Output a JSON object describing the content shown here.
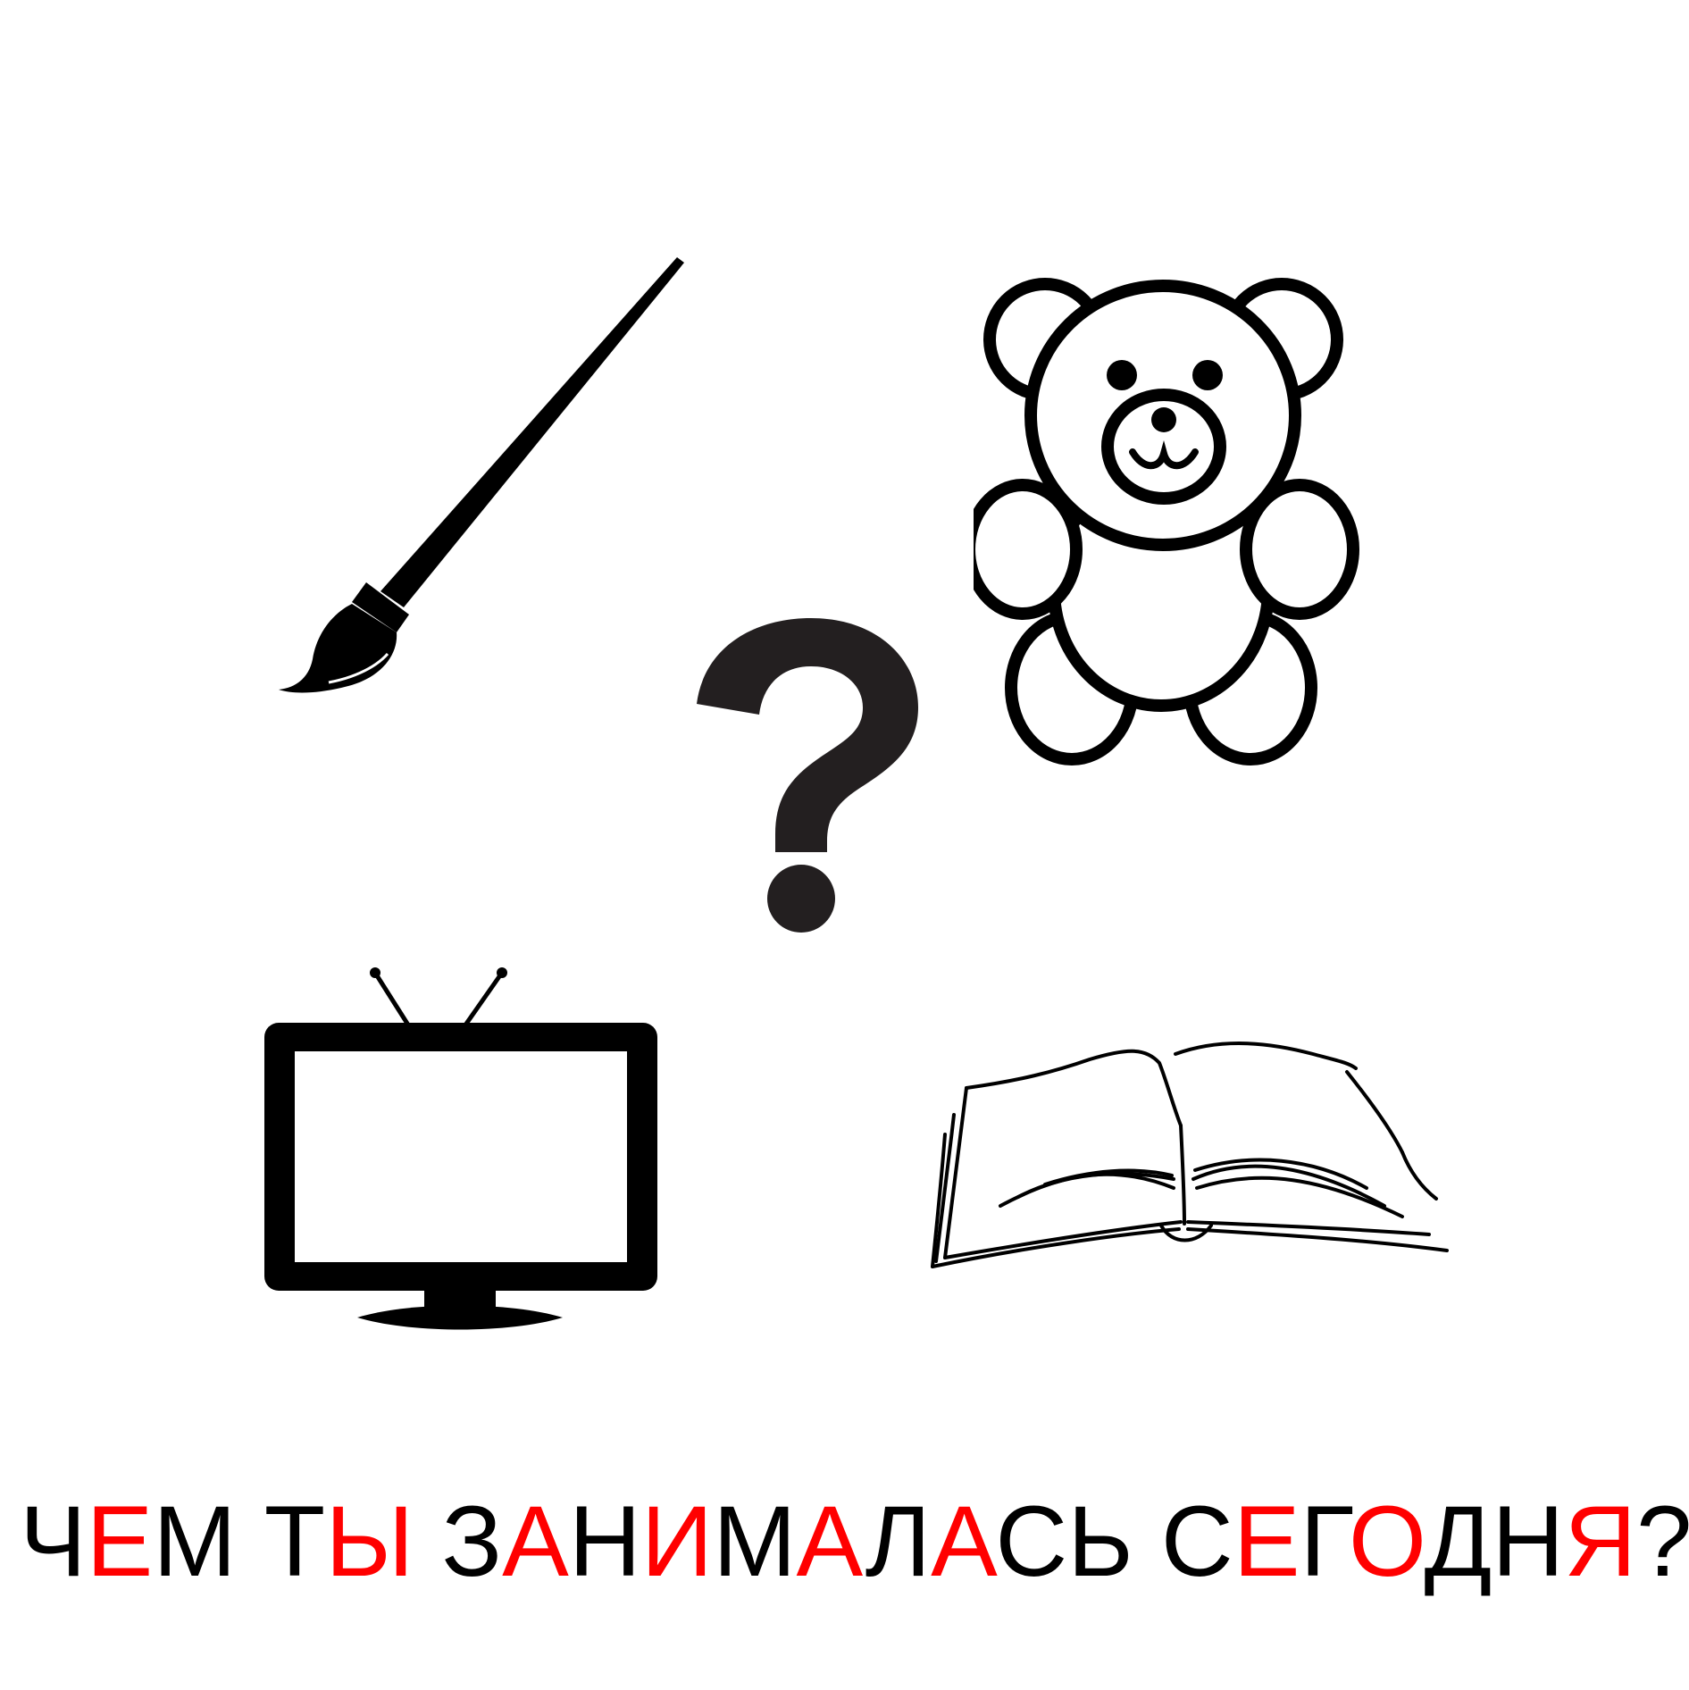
{
  "colors": {
    "normal": "#000000",
    "highlight": "#ff0000",
    "question_mark": "#231f20"
  },
  "icons": [
    "paintbrush-icon",
    "teddy-bear-icon",
    "question-mark-icon",
    "tv-icon",
    "open-book-icon"
  ],
  "caption": {
    "segments": [
      {
        "text": "Ч",
        "hl": false
      },
      {
        "text": "Е",
        "hl": true
      },
      {
        "text": "М Т",
        "hl": false
      },
      {
        "text": "Ы",
        "hl": true
      },
      {
        "text": " З",
        "hl": false
      },
      {
        "text": "А",
        "hl": true
      },
      {
        "text": "Н",
        "hl": false
      },
      {
        "text": "И",
        "hl": true
      },
      {
        "text": "М",
        "hl": false
      },
      {
        "text": "А",
        "hl": true
      },
      {
        "text": "Л",
        "hl": false
      },
      {
        "text": "А",
        "hl": true
      },
      {
        "text": "СЬ С",
        "hl": false
      },
      {
        "text": "Е",
        "hl": true
      },
      {
        "text": "Г",
        "hl": false
      },
      {
        "text": "О",
        "hl": true
      },
      {
        "text": "ДН",
        "hl": false
      },
      {
        "text": "Я",
        "hl": true
      },
      {
        "text": "?",
        "hl": false
      }
    ]
  }
}
